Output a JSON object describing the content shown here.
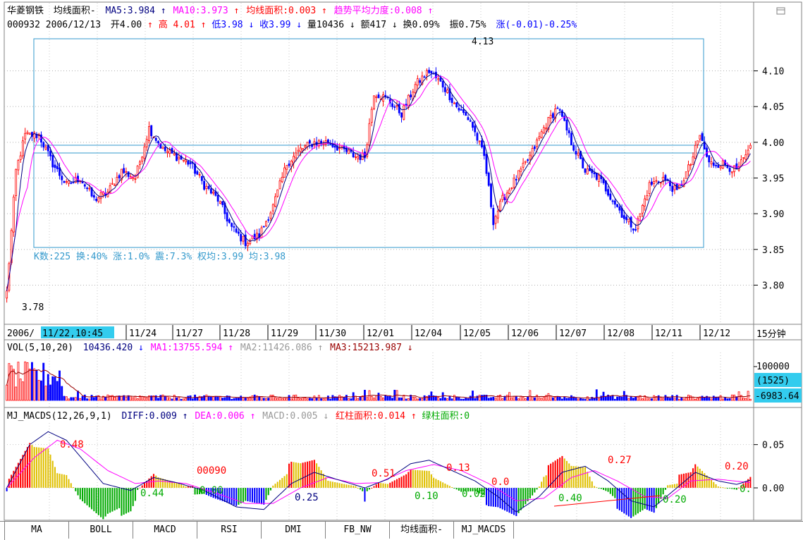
{
  "stock": {
    "name": "华菱钢铁",
    "code": "000932"
  },
  "main_header": {
    "indicator_name": "均线面积-",
    "ma5": "MA5:3.984",
    "ma10": "MA10:3.973",
    "area": "均线面积:0.003",
    "trend": "趋势平均力度:0.008"
  },
  "quote": {
    "code_date": "000932 2006/12/13",
    "open": "开4.00",
    "high_label": "高",
    "high_value": "4.01",
    "low": "低3.98",
    "close": "收3.99",
    "volume": "量10436",
    "amount": "额417",
    "turnover": "换0.09%",
    "amplitude": "振0.75%",
    "change": "涨(-0.01)-0.25%"
  },
  "box_stats": "K数:225 换:40% 涨:1.0% 震:7.3% 权均:3.99 均:3.98",
  "price_marks": {
    "high": "4.13",
    "low": "3.78"
  },
  "dates": {
    "year_prefix": "2006/",
    "highlight": "11/22,10:45",
    "labels": [
      "11/24",
      "11/27",
      "11/28",
      "11/29",
      "11/30",
      "12/01",
      "12/04",
      "12/05",
      "12/06",
      "12/07",
      "12/08",
      "12/11",
      "12/12"
    ],
    "period": "15分钟"
  },
  "vol_header": {
    "name": "VOL(5,10,20)",
    "value": "10436.420",
    "ma1": "MA1:13755.594",
    "ma2": "MA2:11426.086",
    "ma3": "MA3:15213.987"
  },
  "vol_axis": {
    "top": "100000",
    "box": "(1525)",
    "bottom": "-6983.64"
  },
  "macd_header": {
    "name": "MJ_MACDS(12,26,9,1)",
    "diff": "DIFF:0.009",
    "dea": "DEA:0.006",
    "macd": "MACD:0.005",
    "red_area": "红柱面积:0.014",
    "green_area": "绿柱面积:0"
  },
  "macd_annotations": [
    "0.48",
    "00090",
    "0.44",
    "0.00",
    "0.25",
    "0.51",
    "0.10",
    "0.13",
    "0.02",
    "0.0",
    "0.40",
    "0.27",
    "0.20",
    "0.20",
    "0."
  ],
  "tabs": [
    "MA",
    "BOLL",
    "MACD",
    "RSI",
    "DMI",
    "FB_NW",
    "均线面积-",
    "MJ_MACDS"
  ],
  "colors": {
    "up": "#ff0000",
    "down": "#0000ff",
    "ma5": "#000080",
    "ma10": "#ff00ff",
    "box": "#3399cc",
    "highlight": "#33ccee",
    "green": "#00aa00",
    "yellow": "#e0c000"
  },
  "chart_data": [
    {
      "type": "candlestick",
      "title": "华菱钢铁 均线面积-",
      "ylim": [
        3.76,
        4.14
      ],
      "y_ticks": [
        3.8,
        3.85,
        3.9,
        3.95,
        4.0,
        4.05,
        4.1
      ],
      "series": [
        {
          "name": "MA5",
          "values": "running 5-bar mean of close"
        },
        {
          "name": "MA10",
          "values": "running 10-bar mean of close"
        }
      ],
      "anchors_close": [
        [
          0,
          3.79
        ],
        [
          4,
          3.96
        ],
        [
          8,
          4.01
        ],
        [
          14,
          4.01
        ],
        [
          20,
          3.97
        ],
        [
          26,
          3.94
        ],
        [
          32,
          3.95
        ],
        [
          38,
          3.92
        ],
        [
          44,
          3.93
        ],
        [
          50,
          3.96
        ],
        [
          56,
          3.95
        ],
        [
          62,
          4.02
        ],
        [
          68,
          3.99
        ],
        [
          74,
          3.98
        ],
        [
          80,
          3.97
        ],
        [
          86,
          3.94
        ],
        [
          92,
          3.92
        ],
        [
          98,
          3.88
        ],
        [
          104,
          3.86
        ],
        [
          110,
          3.87
        ],
        [
          116,
          3.91
        ],
        [
          122,
          3.97
        ],
        [
          128,
          3.99
        ],
        [
          134,
          4.0
        ],
        [
          140,
          4.0
        ],
        [
          146,
          3.99
        ],
        [
          152,
          3.98
        ],
        [
          156,
          3.98
        ],
        [
          160,
          4.07
        ],
        [
          166,
          4.06
        ],
        [
          172,
          4.04
        ],
        [
          178,
          4.08
        ],
        [
          184,
          4.1
        ],
        [
          190,
          4.08
        ],
        [
          196,
          4.05
        ],
        [
          202,
          4.03
        ],
        [
          208,
          3.98
        ],
        [
          212,
          3.89
        ],
        [
          216,
          3.92
        ],
        [
          222,
          3.95
        ],
        [
          228,
          3.98
        ],
        [
          234,
          4.02
        ],
        [
          240,
          4.05
        ],
        [
          246,
          4.0
        ],
        [
          252,
          3.96
        ],
        [
          258,
          3.95
        ],
        [
          264,
          3.92
        ],
        [
          270,
          3.89
        ],
        [
          274,
          3.88
        ],
        [
          280,
          3.94
        ],
        [
          286,
          3.95
        ],
        [
          292,
          3.93
        ],
        [
          298,
          3.97
        ],
        [
          302,
          4.01
        ],
        [
          306,
          3.97
        ],
        [
          312,
          3.97
        ],
        [
          318,
          3.96
        ],
        [
          324,
          3.99
        ]
      ],
      "n_bars": 325
    },
    {
      "type": "bar",
      "title": "VOL(5,10,20)",
      "ylim": [
        0,
        130000
      ],
      "y_ticks": [
        100000
      ],
      "values_pattern": "high at start (~100000), thereafter mostly 5000-25000 per bar"
    },
    {
      "type": "bar",
      "title": "MJ_MACDS(12,26,9,1)",
      "ylim": [
        -0.035,
        0.075
      ],
      "y_ticks": [
        0.0,
        0.05
      ],
      "series": [
        {
          "name": "DIFF",
          "anchors": [
            [
              0,
              0.0
            ],
            [
              10,
              0.05
            ],
            [
              18,
              0.065
            ],
            [
              26,
              0.055
            ],
            [
              34,
              0.03
            ],
            [
              42,
              0.005
            ],
            [
              54,
              -0.003
            ],
            [
              64,
              0.012
            ],
            [
              74,
              0.006
            ],
            [
              86,
              -0.003
            ],
            [
              100,
              -0.022
            ],
            [
              112,
              -0.025
            ],
            [
              124,
              0.005
            ],
            [
              134,
              0.018
            ],
            [
              146,
              0.008
            ],
            [
              156,
              0.0
            ],
            [
              166,
              0.01
            ],
            [
              176,
              0.028
            ],
            [
              184,
              0.032
            ],
            [
              194,
              0.02
            ],
            [
              204,
              0.008
            ],
            [
              214,
              -0.01
            ],
            [
              222,
              -0.028
            ],
            [
              232,
              -0.01
            ],
            [
              242,
              0.018
            ],
            [
              252,
              0.025
            ],
            [
              262,
              0.008
            ],
            [
              272,
              -0.015
            ],
            [
              282,
              -0.022
            ],
            [
              292,
              0.0
            ],
            [
              300,
              0.018
            ],
            [
              310,
              0.008
            ],
            [
              318,
              0.004
            ],
            [
              324,
              0.009
            ]
          ]
        },
        {
          "name": "DEA",
          "anchors": [
            [
              0,
              0.0
            ],
            [
              12,
              0.035
            ],
            [
              22,
              0.055
            ],
            [
              32,
              0.045
            ],
            [
              44,
              0.02
            ],
            [
              56,
              0.005
            ],
            [
              66,
              0.008
            ],
            [
              78,
              0.005
            ],
            [
              90,
              -0.005
            ],
            [
              104,
              -0.018
            ],
            [
              116,
              -0.018
            ],
            [
              128,
              0.0
            ],
            [
              140,
              0.012
            ],
            [
              152,
              0.005
            ],
            [
              162,
              0.006
            ],
            [
              174,
              0.02
            ],
            [
              186,
              0.027
            ],
            [
              198,
              0.02
            ],
            [
              210,
              0.005
            ],
            [
              222,
              -0.015
            ],
            [
              234,
              -0.012
            ],
            [
              246,
              0.012
            ],
            [
              256,
              0.02
            ],
            [
              266,
              0.008
            ],
            [
              278,
              -0.01
            ],
            [
              288,
              -0.012
            ],
            [
              298,
              0.008
            ],
            [
              310,
              0.01
            ],
            [
              324,
              0.006
            ]
          ]
        }
      ]
    }
  ]
}
